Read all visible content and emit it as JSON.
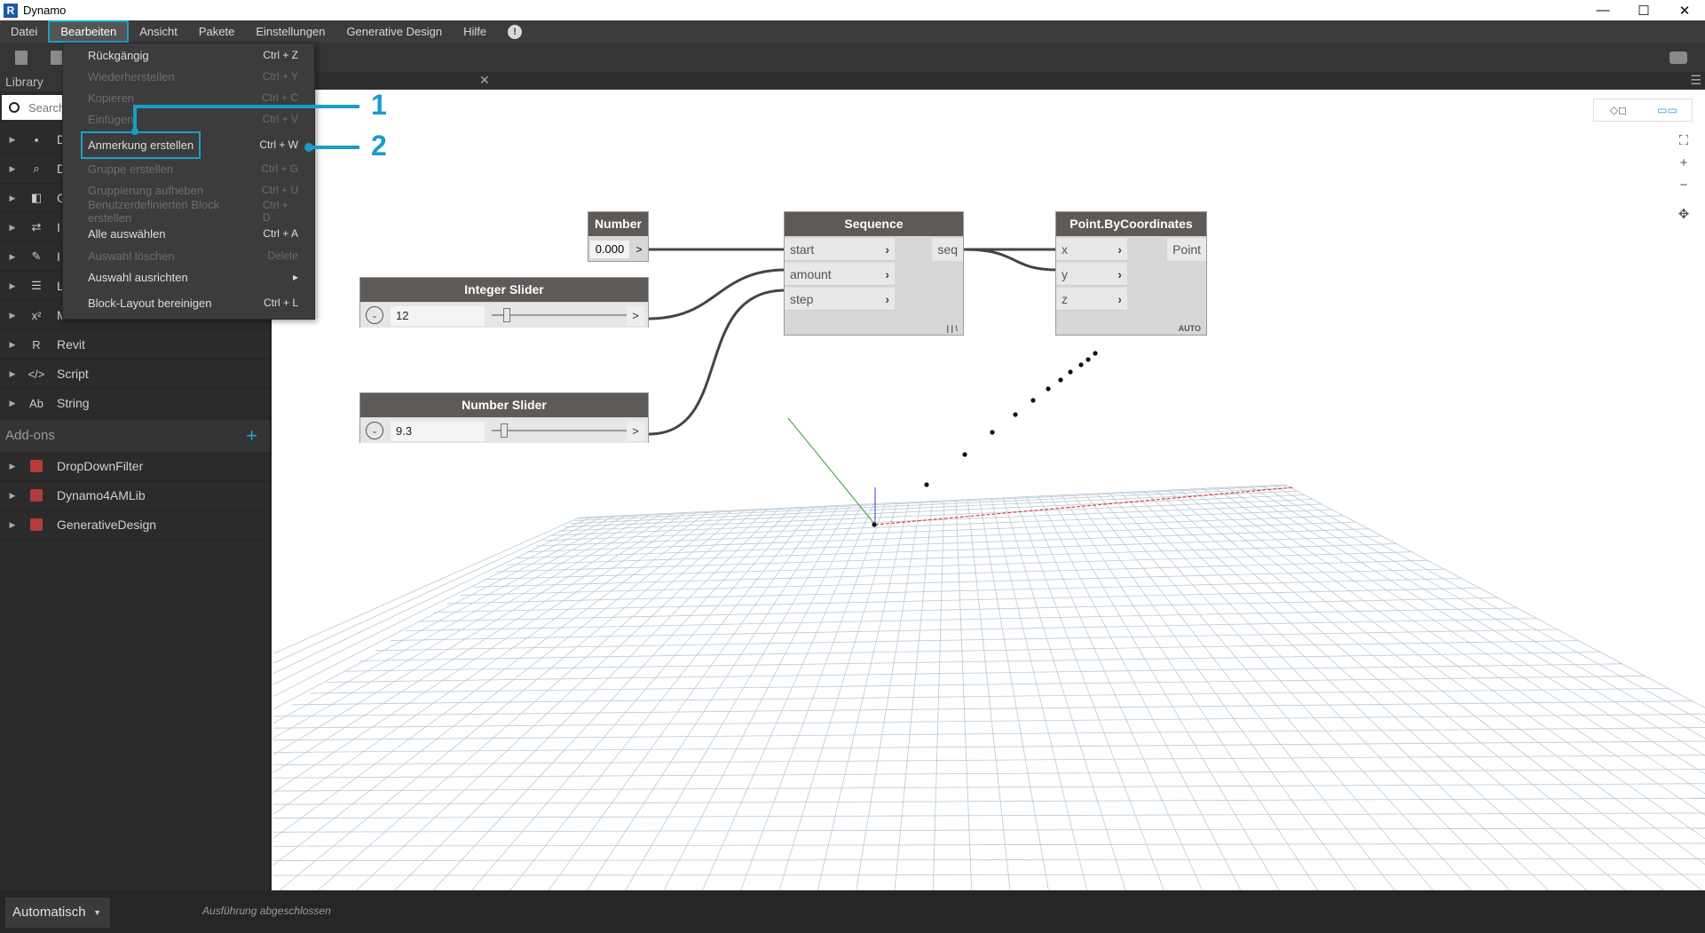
{
  "titlebar": {
    "logo": "R",
    "title": "Dynamo",
    "min": "—",
    "max": "☐",
    "close": "✕"
  },
  "menubar": {
    "items": [
      "Datei",
      "Bearbeiten",
      "Ansicht",
      "Pakete",
      "Einstellungen",
      "Generative Design",
      "Hilfe"
    ],
    "info_icon": "!"
  },
  "edit_menu": {
    "items": [
      {
        "label": "Rückgängig",
        "shortcut": "Ctrl + Z",
        "enabled": true
      },
      {
        "label": "Wiederherstellen",
        "shortcut": "Ctrl + Y",
        "enabled": false
      },
      {
        "label": "Kopieren",
        "shortcut": "Ctrl + C",
        "enabled": false
      },
      {
        "label": "Einfügen",
        "shortcut": "Ctrl + V",
        "enabled": false
      },
      {
        "label": "Anmerkung erstellen",
        "shortcut": "Ctrl + W",
        "enabled": true
      },
      {
        "label": "Gruppe erstellen",
        "shortcut": "Ctrl + G",
        "enabled": false
      },
      {
        "label": "Gruppierung aufheben",
        "shortcut": "Ctrl + U",
        "enabled": false
      },
      {
        "label": "Benutzerdefinierten Block erstellen",
        "shortcut": "Ctrl + D",
        "enabled": false
      },
      {
        "label": "Alle auswählen",
        "shortcut": "Ctrl + A",
        "enabled": true
      },
      {
        "label": "Auswahl löschen",
        "shortcut": "Delete",
        "enabled": false
      },
      {
        "label": "Auswahl ausrichten",
        "shortcut": "▸",
        "enabled": true
      },
      {
        "label": "Block-Layout bereinigen",
        "shortcut": "Ctrl + L",
        "enabled": true
      }
    ]
  },
  "callouts": [
    "1",
    "2"
  ],
  "library": {
    "header": "Library",
    "search_placeholder": "Search",
    "categories": [
      {
        "label": "D",
        "icon": "document-icon"
      },
      {
        "label": "D",
        "icon": "search-icon"
      },
      {
        "label": "G",
        "icon": "cube-icon"
      },
      {
        "label": "I",
        "icon": "arrows-icon"
      },
      {
        "label": "I",
        "icon": "pencil-icon"
      },
      {
        "label": "L",
        "icon": "list-icon"
      },
      {
        "label": "Math",
        "icon": "math-icon"
      },
      {
        "label": "Revit",
        "icon": "revit-icon"
      },
      {
        "label": "Script",
        "icon": "code-icon"
      },
      {
        "label": "String",
        "icon": "string-icon"
      }
    ],
    "icon_glyphs": [
      "▪",
      "⌕",
      "◧",
      "⇄",
      "✎",
      "☰",
      "x²",
      "R",
      "</>",
      "Ab"
    ],
    "addons_header": "Add-ons",
    "addons": [
      "DropDownFilter",
      "Dynamo4AMLib",
      "GenerativeDesign"
    ]
  },
  "nodes": {
    "number": {
      "title": "Number",
      "value": "0.000",
      "out": ">"
    },
    "integer_slider": {
      "title": "Integer Slider",
      "value": "12",
      "out": ">",
      "fraction": 0.06
    },
    "number_slider": {
      "title": "Number Slider",
      "value": "9.3",
      "out": ">",
      "fraction": 0.04
    },
    "sequence": {
      "title": "Sequence",
      "inputs": [
        "start",
        "amount",
        "step"
      ],
      "output": "seq",
      "lacing": "| | \\"
    },
    "point": {
      "title": "Point.ByCoordinates",
      "inputs": [
        "x",
        "y",
        "z"
      ],
      "output": "Point",
      "lacing": "AUTO"
    }
  },
  "canvas": {
    "zoom_fit": "⛶",
    "zoom_in": "+",
    "zoom_out": "−",
    "pan": "✥"
  },
  "statusbar": {
    "run_mode": "Automatisch",
    "status": "Ausführung abgeschlossen"
  },
  "colors": {
    "accent": "#1aa0c9",
    "menubar": "#3c3c3c",
    "library": "#2b2b2b",
    "node_header": "#5e5a58"
  }
}
